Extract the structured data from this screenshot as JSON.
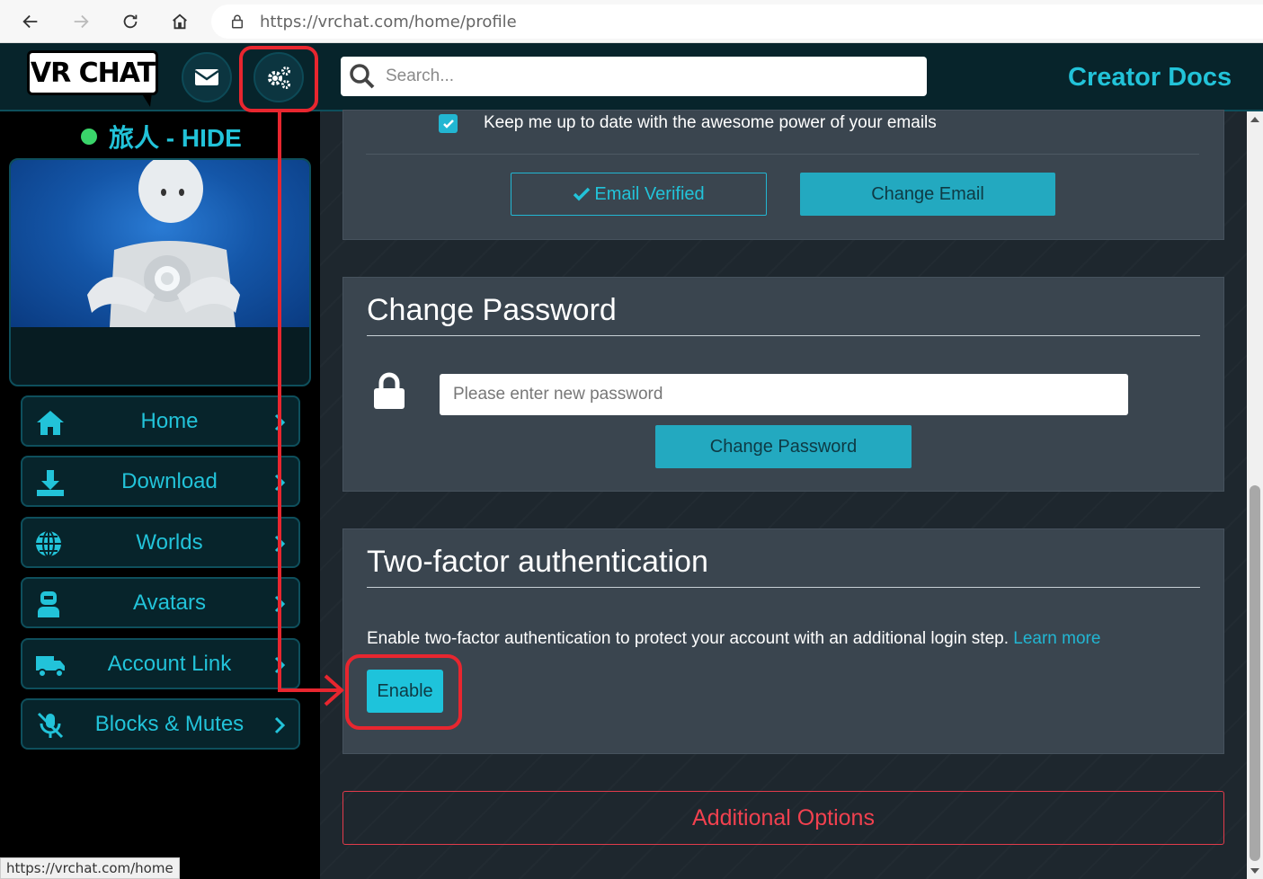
{
  "browser": {
    "url": "https://vrchat.com/home/profile",
    "status_url": "https://vrchat.com/home"
  },
  "header": {
    "logo_text": "VR CHAT",
    "search_placeholder": "Search...",
    "creator_docs": "Creator Docs",
    "mail_icon": "envelope-icon",
    "settings_icon": "gears-icon"
  },
  "sidebar": {
    "username": "旅人 - HIDE",
    "status_color": "#3ad56a",
    "items": [
      {
        "label": "Home",
        "icon": "home-icon"
      },
      {
        "label": "Download",
        "icon": "download-icon"
      },
      {
        "label": "Worlds",
        "icon": "globe-icon"
      },
      {
        "label": "Avatars",
        "icon": "avatar-icon"
      },
      {
        "label": "Account Link",
        "icon": "truck-icon"
      },
      {
        "label": "Blocks & Mutes",
        "icon": "mute-icon"
      }
    ]
  },
  "email_panel": {
    "checkbox_label": "Keep me up to date with the awesome power of your emails",
    "checkbox_checked": true,
    "verified_label": "Email Verified",
    "change_email_label": "Change Email"
  },
  "password_panel": {
    "title": "Change Password",
    "placeholder": "Please enter new password",
    "button_label": "Change Password"
  },
  "tfa_panel": {
    "title": "Two-factor authentication",
    "description": "Enable two-factor authentication to protect your account with an additional login step.",
    "learn_more": "Learn more",
    "enable_label": "Enable"
  },
  "additional_options": "Additional Options",
  "colors": {
    "accent": "#22c3d9",
    "danger": "#f2414f",
    "annotation": "#e8262f"
  }
}
